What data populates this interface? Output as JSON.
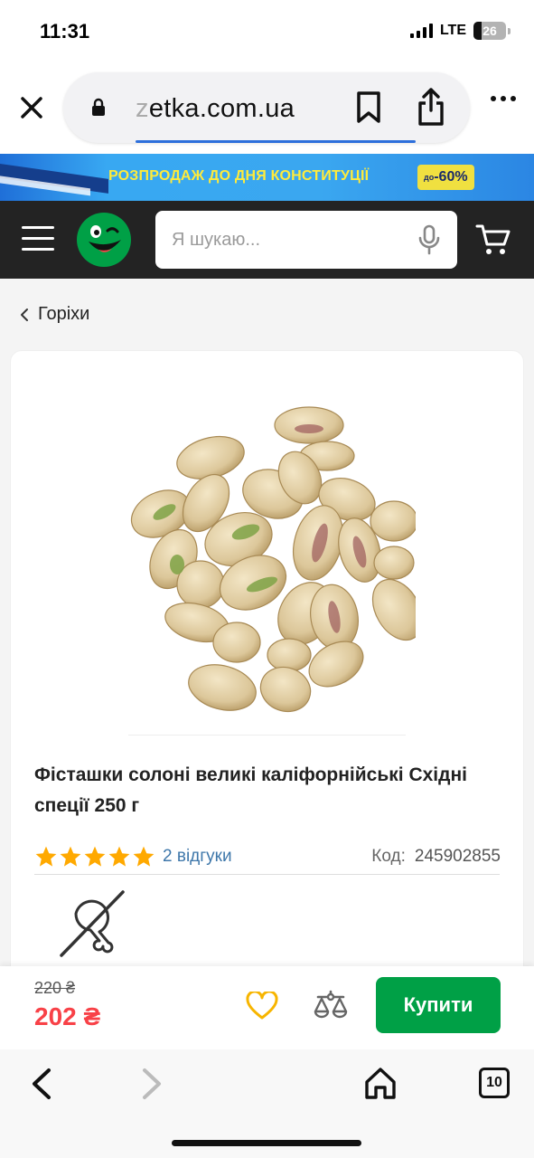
{
  "status_bar": {
    "time": "11:31",
    "network": "LTE",
    "battery": "26"
  },
  "browser": {
    "url_faded": "z",
    "url": "etka.com.ua",
    "icons": [
      "close-icon",
      "lock-icon",
      "bookmark-icon",
      "share-icon",
      "more-icon"
    ]
  },
  "promo": {
    "text": "РОЗПРОДАЖ ДО ДНЯ КОНСТИТУЦІЇ",
    "badge_prefix": "до",
    "badge": "-60%",
    "colors": {
      "background": "#38a8f2",
      "text": "#ffeb3b",
      "badge": "#f0e040"
    }
  },
  "header": {
    "search_placeholder": "Я шукаю...",
    "icons": [
      "menu-icon",
      "rozetka-logo",
      "mic-icon",
      "cart-icon"
    ],
    "colors": {
      "background": "#232323",
      "logo": "#00a046"
    }
  },
  "breadcrumb": {
    "label": "Горіхи"
  },
  "product": {
    "title": "Фісташки солоні великі каліфорнійські Східні спеції 250 г",
    "rating": 5,
    "rating_max": 5,
    "reviews": "2 відгуки",
    "code_label": "Код:",
    "code_value": "245902855"
  },
  "purchase": {
    "old_price": "220 ₴",
    "price": "202 ₴",
    "buy_label": "Купити",
    "colors": {
      "price": "#f84147",
      "buy": "#00a046",
      "heart": "#f7b500"
    }
  },
  "toolbar": {
    "tabs_count": "10"
  }
}
